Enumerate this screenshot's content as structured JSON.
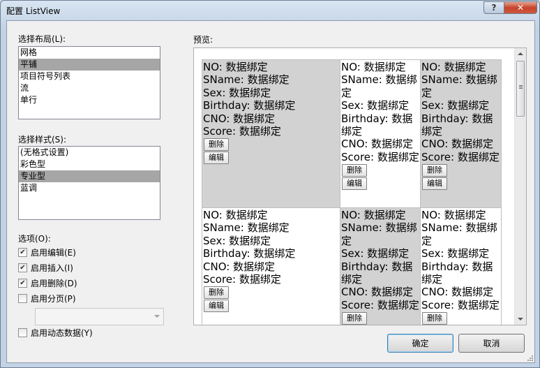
{
  "window": {
    "title": "配置 ListView",
    "help": "?",
    "close": "✕"
  },
  "layout_section": {
    "label": "选择布局(L):",
    "items": [
      "网格",
      "平铺",
      "项目符号列表",
      "流",
      "单行"
    ],
    "selected": 1
  },
  "style_section": {
    "label": "选择样式(S):",
    "items": [
      "(无格式设置)",
      "彩色型",
      "专业型",
      "蓝调"
    ],
    "selected": 2
  },
  "options": {
    "label": "选项(O):",
    "enable_edit": {
      "label": "启用编辑(E)",
      "checked": true
    },
    "enable_insert": {
      "label": "启用插入(I)",
      "checked": true
    },
    "enable_delete": {
      "label": "启用删除(D)",
      "checked": true
    },
    "enable_paging": {
      "label": "启用分页(P)",
      "checked": false
    },
    "paging_combo_value": "",
    "enable_dynamic_data": {
      "label": "启用动态数据(Y)",
      "checked": false
    }
  },
  "preview": {
    "label": "预览:",
    "fields": [
      "NO: 数据绑定",
      "SName: 数据绑定",
      "Sex: 数据绑定",
      "Birthday: 数据绑定",
      "CNO: 数据绑定",
      "Score: 数据绑定"
    ],
    "delete_label": "删除",
    "edit_label": "编辑"
  },
  "buttons": {
    "ok": "确定",
    "cancel": "取消"
  }
}
